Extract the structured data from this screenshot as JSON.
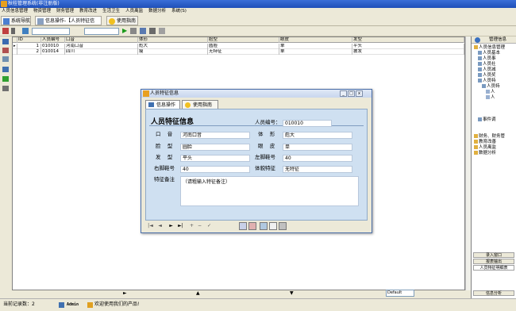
{
  "window": {
    "title": "秋桂管理系统(非注册版)"
  },
  "menu": [
    "人员信息管理",
    "物资管理",
    "财务管理",
    "教育改进",
    "生活卫生",
    "人员离监",
    "数据分析",
    "系统(S)"
  ],
  "tabs": {
    "nav_label": "系统导航",
    "info_op_label": "信息操作-【人员特征信息】",
    "guide_label": "使用指南"
  },
  "toolbar": {
    "select1_value": "",
    "select2_value": ""
  },
  "table": {
    "columns": [
      "ID",
      "人员编号",
      "口音",
      "体形",
      "脸型",
      "眼皮",
      "发型"
    ],
    "rows": [
      {
        "id": "1",
        "num": "010010",
        "accent": "河南口音",
        "body": "彪大",
        "face": "圆脸",
        "eyelid": "单",
        "hair": "平头"
      },
      {
        "id": "2",
        "num": "010014",
        "accent": "四川",
        "body": "瘦",
        "face": "无特征",
        "eyelid": "单",
        "hair": "披发"
      }
    ]
  },
  "right_panel": {
    "header": "管理信息",
    "tree": [
      "人员信息管理",
      "人员基本",
      "人员事",
      "人员社",
      "人员减",
      "人员奖",
      "人员特",
      "人员特",
      "人",
      "人",
      "事件调",
      "财务、财务管",
      "教育改善",
      "人员离监",
      "数据分析"
    ],
    "buttons": [
      "录入窗口",
      "报表输出",
      "人员特征明细表"
    ],
    "bottom": "信息分析"
  },
  "dialog": {
    "title": "人员特征信息",
    "tab_op": "信息操作",
    "tab_guide": "使用指南",
    "form_title": "人员特征信息",
    "fields": {
      "num_label": "人员编号：",
      "num_value": "010010",
      "accent_label": "口    音",
      "accent_value": "河南口音",
      "body_label": "体    形",
      "body_value": "彪大",
      "face_label": "脸    型",
      "face_value": "圆脸",
      "eyelid_label": "眼    皮",
      "eyelid_value": "单",
      "hair_label": "发    型",
      "hair_value": "平头",
      "leftshoe_label": "左脚鞋号",
      "leftshoe_value": "40",
      "rightshoe_label": "右脚鞋号",
      "rightshoe_value": "40",
      "physical_label": "体貌特征",
      "physical_value": "无特征",
      "remark_label": "特征备注",
      "remark_value": "（请粗输入特征备注）"
    }
  },
  "status": {
    "record_count": "当前记录数：2",
    "user": "Admin",
    "welcome": "欢迎使用我们的产品!",
    "theme": "Default"
  },
  "colors": {
    "titlebar": "#2a5fc8",
    "form_bg": "#cfe0f1"
  }
}
